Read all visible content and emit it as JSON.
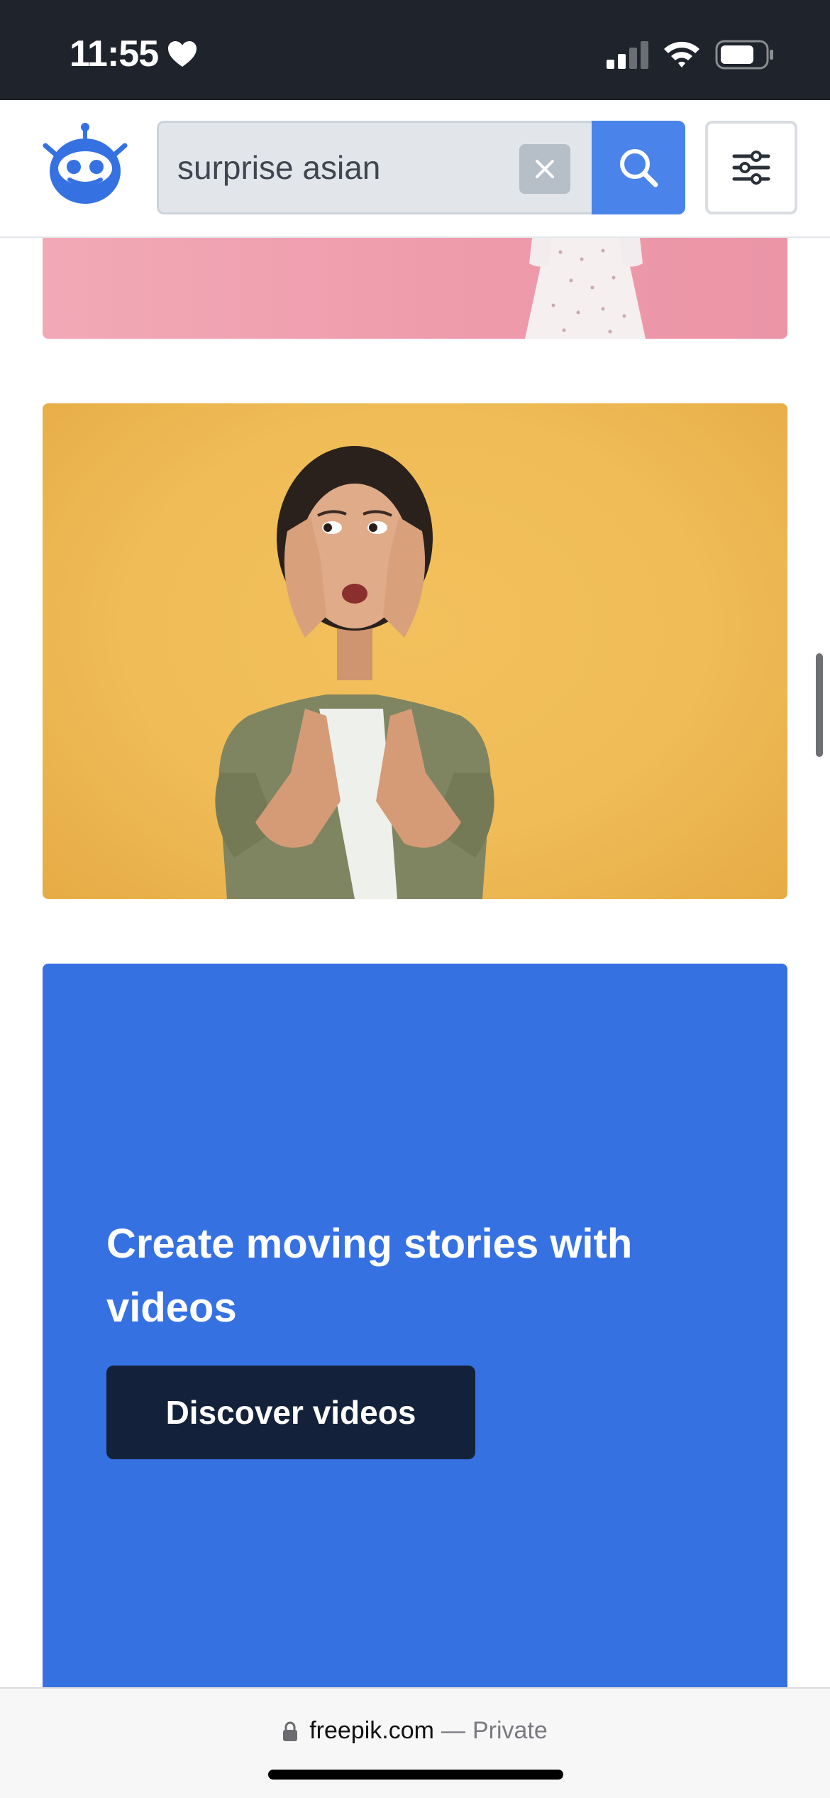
{
  "status_bar": {
    "time": "11:55",
    "icons": [
      "heart-icon",
      "signal-icon",
      "wifi-icon",
      "battery-icon"
    ]
  },
  "header": {
    "logo": "freepik-robot-logo",
    "search": {
      "value": "surprise asian",
      "placeholder": ""
    },
    "clear_icon": "close-icon",
    "search_icon": "search-icon",
    "filter_icon": "sliders-icon"
  },
  "colors": {
    "accent": "#4a84ea",
    "promo_background": "#3671e2",
    "promo_button": "#14213a",
    "status_bar": "#1f232b"
  },
  "results": [
    {
      "kind": "image",
      "description_color": "#f2a9b6"
    },
    {
      "kind": "image",
      "description_color": "#f0bc56"
    }
  ],
  "promo": {
    "heading": "Create moving stories with videos",
    "button_label": "Discover videos"
  },
  "browser": {
    "domain": "freepik.com",
    "separator": "—",
    "mode": "Private"
  }
}
